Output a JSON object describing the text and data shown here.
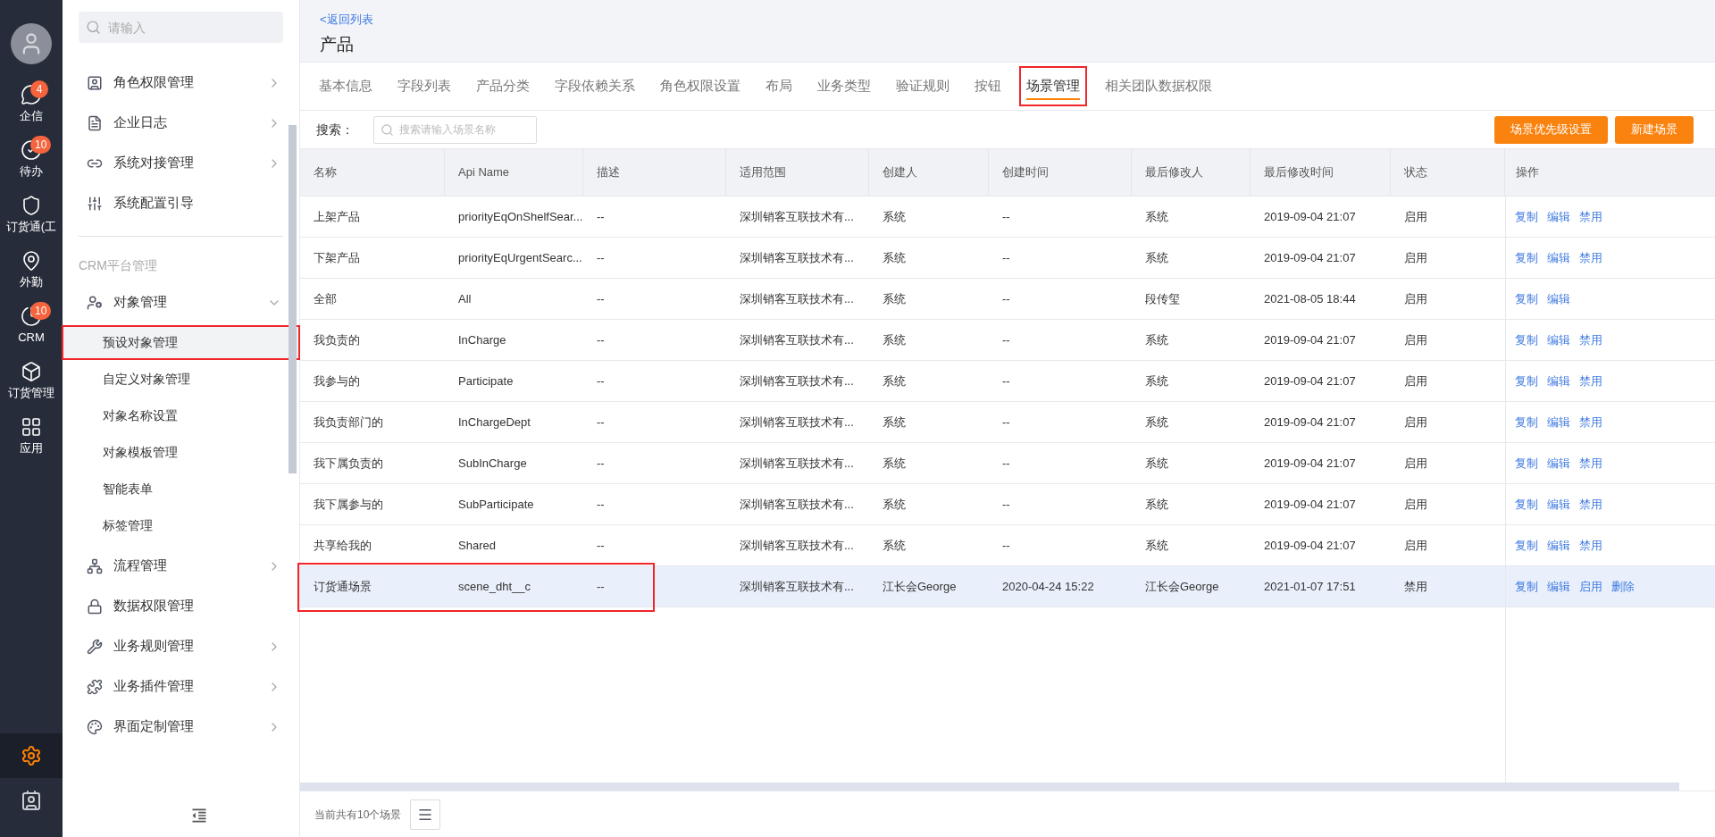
{
  "rail": {
    "items": [
      {
        "label": "企信",
        "badge": "4"
      },
      {
        "label": "待办",
        "badge": "10"
      },
      {
        "label": "订货通(工"
      },
      {
        "label": "外勤"
      },
      {
        "label": "CRM",
        "badge": "10"
      },
      {
        "label": "订货管理"
      },
      {
        "label": "应用"
      }
    ],
    "bottom": [
      {
        "selected": true
      },
      {
        "selected": false
      }
    ]
  },
  "sidebar": {
    "search": {
      "placeholder": "请输入"
    },
    "top_items": [
      {
        "label": "角色权限管理",
        "expandable": true,
        "expanded": false
      },
      {
        "label": "企业日志",
        "expandable": true,
        "expanded": false
      },
      {
        "label": "系统对接管理",
        "expandable": true,
        "expanded": false
      },
      {
        "label": "系统配置引导",
        "expandable": false
      }
    ],
    "section": "CRM平台管理",
    "items": [
      {
        "label": "对象管理",
        "expandable": true,
        "expanded": true,
        "children": [
          {
            "label": "预设对象管理",
            "selected": true,
            "highlighted": true
          },
          {
            "label": "自定义对象管理",
            "selected": false,
            "highlighted": false
          },
          {
            "label": "对象名称设置",
            "selected": false,
            "highlighted": false
          },
          {
            "label": "对象模板管理",
            "selected": false,
            "highlighted": false
          },
          {
            "label": "智能表单",
            "selected": false,
            "highlighted": false
          },
          {
            "label": "标签管理",
            "selected": false,
            "highlighted": false
          }
        ]
      },
      {
        "label": "流程管理",
        "expandable": true,
        "expanded": false
      },
      {
        "label": "数据权限管理",
        "expandable": false
      },
      {
        "label": "业务规则管理",
        "expandable": true,
        "expanded": false
      },
      {
        "label": "业务插件管理",
        "expandable": true,
        "expanded": false
      },
      {
        "label": "界面定制管理",
        "expandable": true,
        "expanded": false
      }
    ]
  },
  "header": {
    "back_link": "<返回列表",
    "title": "产品"
  },
  "tabs": [
    {
      "label": "基本信息",
      "selected": false,
      "highlighted": false
    },
    {
      "label": "字段列表",
      "selected": false,
      "highlighted": false
    },
    {
      "label": "产品分类",
      "selected": false,
      "highlighted": false
    },
    {
      "label": "字段依赖关系",
      "selected": false,
      "highlighted": false
    },
    {
      "label": "角色权限设置",
      "selected": false,
      "highlighted": false
    },
    {
      "label": "布局",
      "selected": false,
      "highlighted": false
    },
    {
      "label": "业务类型",
      "selected": false,
      "highlighted": false
    },
    {
      "label": "验证规则",
      "selected": false,
      "highlighted": false
    },
    {
      "label": "按钮",
      "selected": false,
      "highlighted": false
    },
    {
      "label": "场景管理",
      "selected": true,
      "highlighted": true
    },
    {
      "label": "相关团队数据权限",
      "selected": false,
      "highlighted": false
    }
  ],
  "toolbar": {
    "search_label": "搜索：",
    "search_placeholder": "搜索请输入场景名称",
    "buttons": [
      "场景优先级设置",
      "新建场景"
    ]
  },
  "table": {
    "columns": [
      "名称",
      "Api Name",
      "描述",
      "适用范围",
      "创建人",
      "创建时间",
      "最后修改人",
      "最后修改时间",
      "状态",
      "操作"
    ],
    "rows": [
      {
        "cells": [
          "上架产品",
          "priorityEqOnShelfSear...",
          "--",
          "深圳销客互联技术有...",
          "系统",
          "--",
          "系统",
          "2019-09-04 21:07",
          "启用"
        ],
        "actions": [
          "复制",
          "编辑",
          "禁用"
        ],
        "selected": false,
        "highlighted": false
      },
      {
        "cells": [
          "下架产品",
          "priorityEqUrgentSearc...",
          "--",
          "深圳销客互联技术有...",
          "系统",
          "--",
          "系统",
          "2019-09-04 21:07",
          "启用"
        ],
        "actions": [
          "复制",
          "编辑",
          "禁用"
        ],
        "selected": false,
        "highlighted": false
      },
      {
        "cells": [
          "全部",
          "All",
          "--",
          "深圳销客互联技术有...",
          "系统",
          "--",
          "段传玺",
          "2021-08-05 18:44",
          "启用"
        ],
        "actions": [
          "复制",
          "编辑"
        ],
        "selected": false,
        "highlighted": false
      },
      {
        "cells": [
          "我负责的",
          "InCharge",
          "--",
          "深圳销客互联技术有...",
          "系统",
          "--",
          "系统",
          "2019-09-04 21:07",
          "启用"
        ],
        "actions": [
          "复制",
          "编辑",
          "禁用"
        ],
        "selected": false,
        "highlighted": false
      },
      {
        "cells": [
          "我参与的",
          "Participate",
          "--",
          "深圳销客互联技术有...",
          "系统",
          "--",
          "系统",
          "2019-09-04 21:07",
          "启用"
        ],
        "actions": [
          "复制",
          "编辑",
          "禁用"
        ],
        "selected": false,
        "highlighted": false
      },
      {
        "cells": [
          "我负责部门的",
          "InChargeDept",
          "--",
          "深圳销客互联技术有...",
          "系统",
          "--",
          "系统",
          "2019-09-04 21:07",
          "启用"
        ],
        "actions": [
          "复制",
          "编辑",
          "禁用"
        ],
        "selected": false,
        "highlighted": false
      },
      {
        "cells": [
          "我下属负责的",
          "SubInCharge",
          "--",
          "深圳销客互联技术有...",
          "系统",
          "--",
          "系统",
          "2019-09-04 21:07",
          "启用"
        ],
        "actions": [
          "复制",
          "编辑",
          "禁用"
        ],
        "selected": false,
        "highlighted": false
      },
      {
        "cells": [
          "我下属参与的",
          "SubParticipate",
          "--",
          "深圳销客互联技术有...",
          "系统",
          "--",
          "系统",
          "2019-09-04 21:07",
          "启用"
        ],
        "actions": [
          "复制",
          "编辑",
          "禁用"
        ],
        "selected": false,
        "highlighted": false
      },
      {
        "cells": [
          "共享给我的",
          "Shared",
          "--",
          "深圳销客互联技术有...",
          "系统",
          "--",
          "系统",
          "2019-09-04 21:07",
          "启用"
        ],
        "actions": [
          "复制",
          "编辑",
          "禁用"
        ],
        "selected": false,
        "highlighted": false
      },
      {
        "cells": [
          "订货通场景",
          "scene_dht__c",
          "--",
          "深圳销客互联技术有...",
          "江长会George",
          "2020-04-24 15:22",
          "江长会George",
          "2021-01-07 17:51",
          "禁用"
        ],
        "actions": [
          "复制",
          "编辑",
          "启用",
          "删除"
        ],
        "selected": true,
        "highlighted": true
      }
    ]
  },
  "footer": {
    "summary": "当前共有10个场景"
  }
}
